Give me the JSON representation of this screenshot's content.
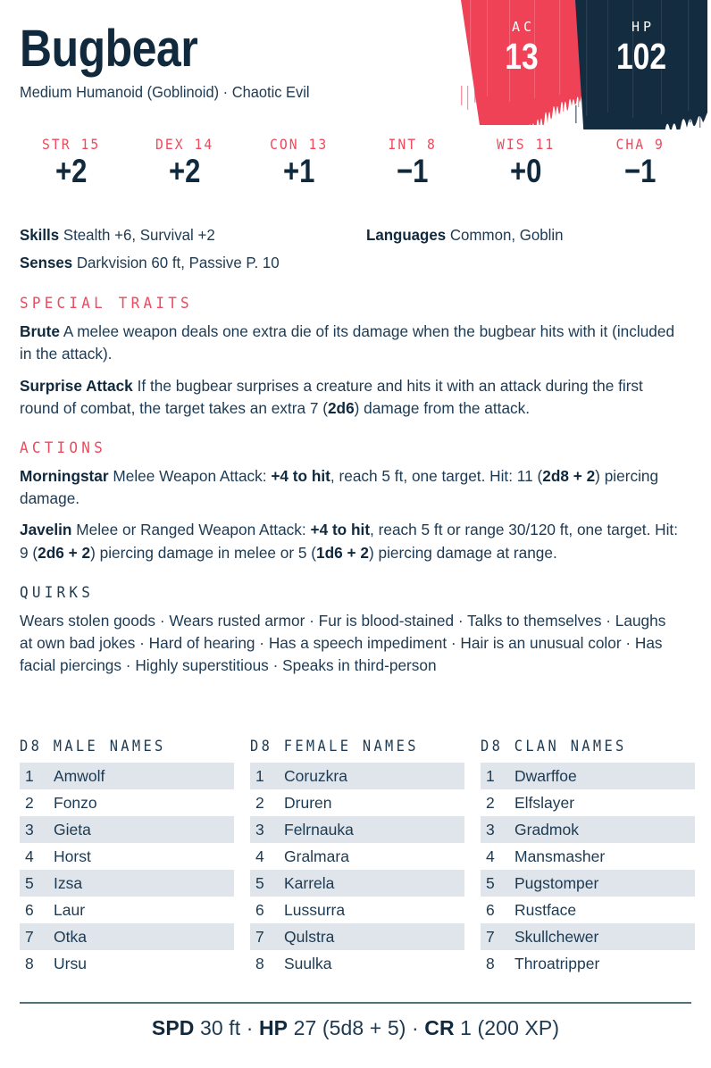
{
  "header": {
    "name": "Bugbear",
    "meta": "Medium Humanoid (Goblinoid) · Chaotic Evil",
    "ac_label": "AC",
    "ac_value": "13",
    "hp_label": "HP",
    "hp_value": "102",
    "ac_color": "#f04257",
    "hp_color": "#132c40"
  },
  "abilities": [
    {
      "name": "STR 15",
      "mod": "+2"
    },
    {
      "name": "DEX 14",
      "mod": "+2"
    },
    {
      "name": "CON 13",
      "mod": "+1"
    },
    {
      "name": "INT 8",
      "mod": "−1"
    },
    {
      "name": "WIS 11",
      "mod": "+0"
    },
    {
      "name": "CHA 9",
      "mod": "−1"
    }
  ],
  "stats": {
    "skills_label": "Skills",
    "skills_value": " Stealth +6, Survival +2",
    "languages_label": "Languages",
    "languages_value": " Common, Goblin",
    "senses_label": "Senses",
    "senses_value": " Darkvision 60 ft, Passive P. 10"
  },
  "special_traits": {
    "heading": "SPECIAL TRAITS",
    "entries": [
      {
        "name": "Brute",
        "text": " A melee weapon deals one extra die of its damage when the bugbear hits with it (included in the attack)."
      },
      {
        "name": "Surprise Attack",
        "text_before": " If the bugbear surprises a creature and hits it with an attack during the first round of combat, the target takes an extra 7 (",
        "dice": "2d6",
        "text_after": ") damage from the attack."
      }
    ]
  },
  "actions": {
    "heading": "ACTIONS",
    "entries": [
      {
        "name": "Morningstar",
        "p1": " Melee Weapon Attack: ",
        "hit": "+4 to hit",
        "p2": ", reach 5 ft, one target. Hit: 11 (",
        "dice1": "2d8 + 2",
        "p3": ") piercing damage."
      },
      {
        "name": "Javelin",
        "p1": " Melee or Ranged Weapon Attack: ",
        "hit": "+4 to hit",
        "p2": ", reach 5 ft or range 30/120 ft, one target. Hit: 9 (",
        "dice1": "2d6 + 2",
        "p3": ") piercing damage in melee or 5 (",
        "dice2": "1d6 + 2",
        "p4": ") piercing damage at range."
      }
    ]
  },
  "quirks": {
    "heading": "QUIRKS",
    "text": "Wears stolen goods · Wears rusted armor · Fur is blood-stained · Talks to themselves · Laughs at own bad jokes · Hard of hearing · Has a speech impediment · Hair is an unusual color · Has facial piercings · Highly superstitious · Speaks in third-person"
  },
  "tables": [
    {
      "heading": "D8 MALE NAMES",
      "rows": [
        {
          "idx": "1",
          "val": "Amwolf"
        },
        {
          "idx": "2",
          "val": "Fonzo"
        },
        {
          "idx": "3",
          "val": "Gieta"
        },
        {
          "idx": "4",
          "val": "Horst"
        },
        {
          "idx": "5",
          "val": "Izsa"
        },
        {
          "idx": "6",
          "val": "Laur"
        },
        {
          "idx": "7",
          "val": "Otka"
        },
        {
          "idx": "8",
          "val": "Ursu"
        }
      ]
    },
    {
      "heading": "D8 FEMALE NAMES",
      "rows": [
        {
          "idx": "1",
          "val": "Coruzkra"
        },
        {
          "idx": "2",
          "val": "Druren"
        },
        {
          "idx": "3",
          "val": "Felrnauka"
        },
        {
          "idx": "4",
          "val": "Gralmara"
        },
        {
          "idx": "5",
          "val": "Karrela"
        },
        {
          "idx": "6",
          "val": "Lussurra"
        },
        {
          "idx": "7",
          "val": "Qulstra"
        },
        {
          "idx": "8",
          "val": "Suulka"
        }
      ]
    },
    {
      "heading": "D8 CLAN NAMES",
      "rows": [
        {
          "idx": "1",
          "val": "Dwarffoe"
        },
        {
          "idx": "2",
          "val": "Elfslayer"
        },
        {
          "idx": "3",
          "val": "Gradmok"
        },
        {
          "idx": "4",
          "val": "Mansmasher"
        },
        {
          "idx": "5",
          "val": "Pugstomper"
        },
        {
          "idx": "6",
          "val": "Rustface"
        },
        {
          "idx": "7",
          "val": "Skullchewer"
        },
        {
          "idx": "8",
          "val": "Throatripper"
        }
      ]
    }
  ],
  "footer": {
    "spd_label": "SPD",
    "spd_value": " 30 ft ",
    "sep1": "· ",
    "hp_label": "HP",
    "hp_value": " 27 (5d8 + 5) ",
    "sep2": "· ",
    "cr_label": "CR",
    "cr_value": " 1 (200 XP)"
  },
  "colors": {
    "accent_red": "#ee4a5e",
    "ink_navy": "#10293d",
    "body_navy": "#1d3a52",
    "row_shade": "#dfe5ea",
    "rule": "#53707f"
  }
}
